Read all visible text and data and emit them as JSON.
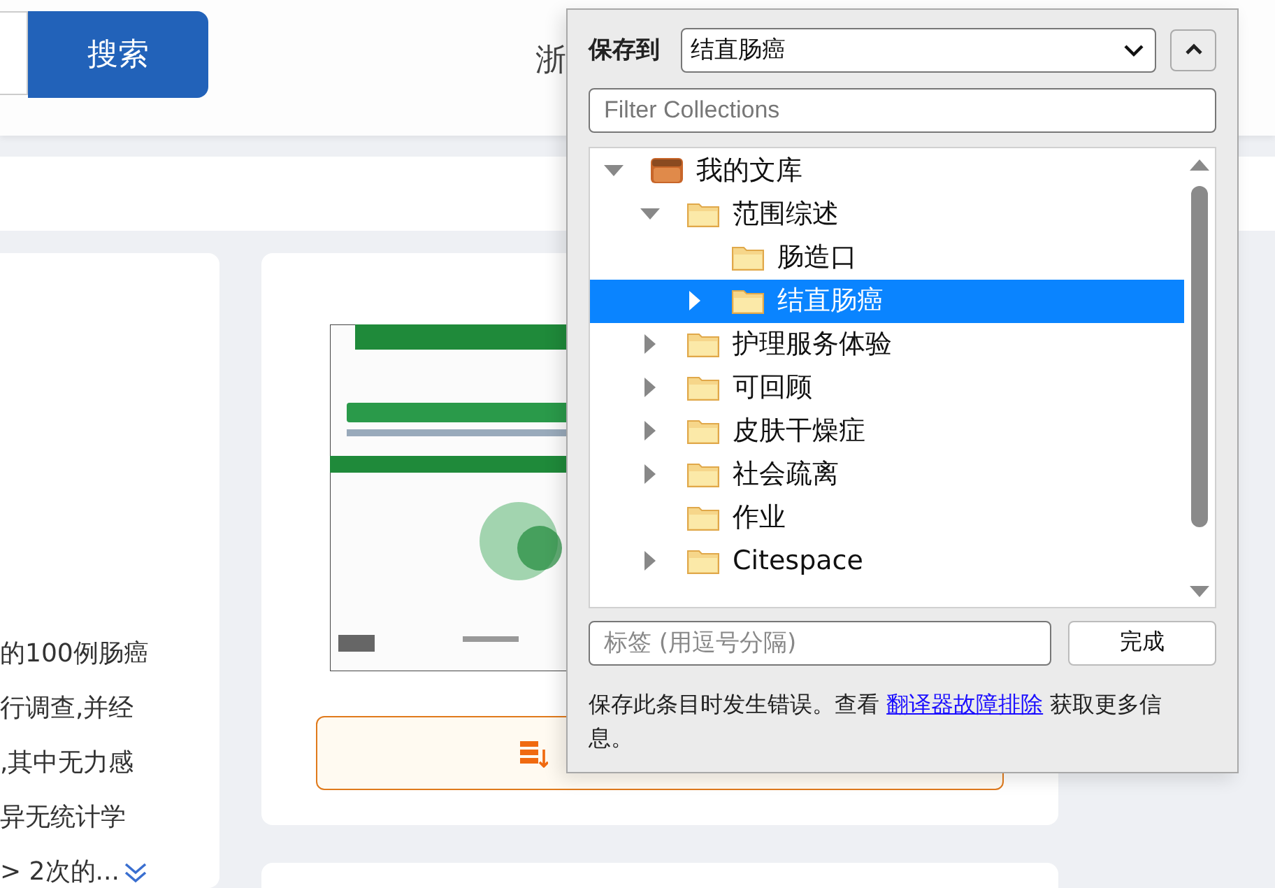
{
  "header": {
    "search_button": "搜索",
    "region_text": "浙"
  },
  "abstract": {
    "lines": [
      "的100例肠癌",
      "行调查,并经",
      ",其中无力感",
      "异无统计学",
      "> 2次的..."
    ]
  },
  "save_popup": {
    "label": "保存到",
    "target": "结直肠癌",
    "filter": {
      "placeholder": "Filter Collections"
    },
    "tree": [
      {
        "name": "我的文库",
        "kind": "library",
        "expandable": true,
        "expanded": true,
        "selected": false,
        "children": [
          {
            "name": "范围综述",
            "kind": "folder",
            "expandable": true,
            "expanded": true,
            "selected": false,
            "children": [
              {
                "name": "肠造口",
                "kind": "folder",
                "expandable": false,
                "selected": false
              },
              {
                "name": "结直肠癌",
                "kind": "folder",
                "expandable": true,
                "expanded": false,
                "selected": true
              }
            ]
          },
          {
            "name": "护理服务体验",
            "kind": "folder",
            "expandable": true,
            "expanded": false,
            "selected": false
          },
          {
            "name": "可回顾",
            "kind": "folder",
            "expandable": true,
            "expanded": false,
            "selected": false
          },
          {
            "name": "皮肤干燥症",
            "kind": "folder",
            "expandable": true,
            "expanded": false,
            "selected": false
          },
          {
            "name": "社会疏离",
            "kind": "folder",
            "expandable": true,
            "expanded": false,
            "selected": false
          },
          {
            "name": "作业",
            "kind": "folder",
            "expandable": false,
            "selected": false
          },
          {
            "name": "Citespace",
            "kind": "folder",
            "expandable": true,
            "expanded": false,
            "selected": false
          }
        ]
      }
    ],
    "tags": {
      "placeholder": "标签 (用逗号分隔)"
    },
    "done_button": "完成",
    "message": {
      "before": "保存此条目时发生错误。查看 ",
      "link": "翻译器故障排除",
      "after": " 获取更多信息。"
    }
  }
}
